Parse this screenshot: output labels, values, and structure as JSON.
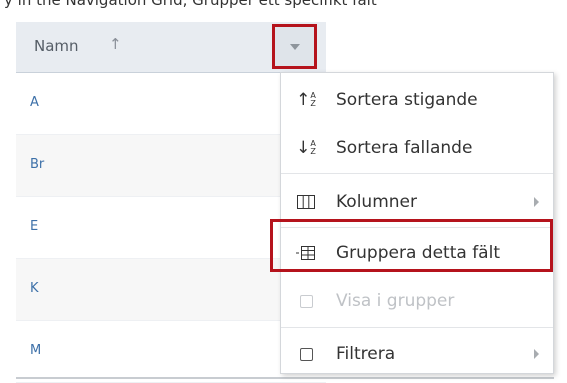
{
  "caption": "y in the Navigation Grid, Grupper ett specifikt fält",
  "grid": {
    "header": {
      "label": "Namn"
    },
    "rows": [
      "A",
      "Br",
      "E",
      "K",
      "M"
    ]
  },
  "menu": {
    "items": [
      {
        "label": "Sortera stigande",
        "icon": "sort-ascending-icon"
      },
      {
        "label": "Sortera fallande",
        "icon": "sort-descending-icon"
      },
      {
        "label": "Kolumner",
        "icon": "columns-icon"
      },
      {
        "label": "Gruppera detta fält",
        "icon": "group-by-field-icon"
      },
      {
        "label": "Visa i grupper",
        "icon": "checkbox-icon"
      },
      {
        "label": "Filtrera",
        "icon": "checkbox-icon"
      }
    ]
  },
  "colors": {
    "highlight": "#b5131c",
    "header_bg": "#e8ecf1",
    "link": "#3d70a8"
  }
}
